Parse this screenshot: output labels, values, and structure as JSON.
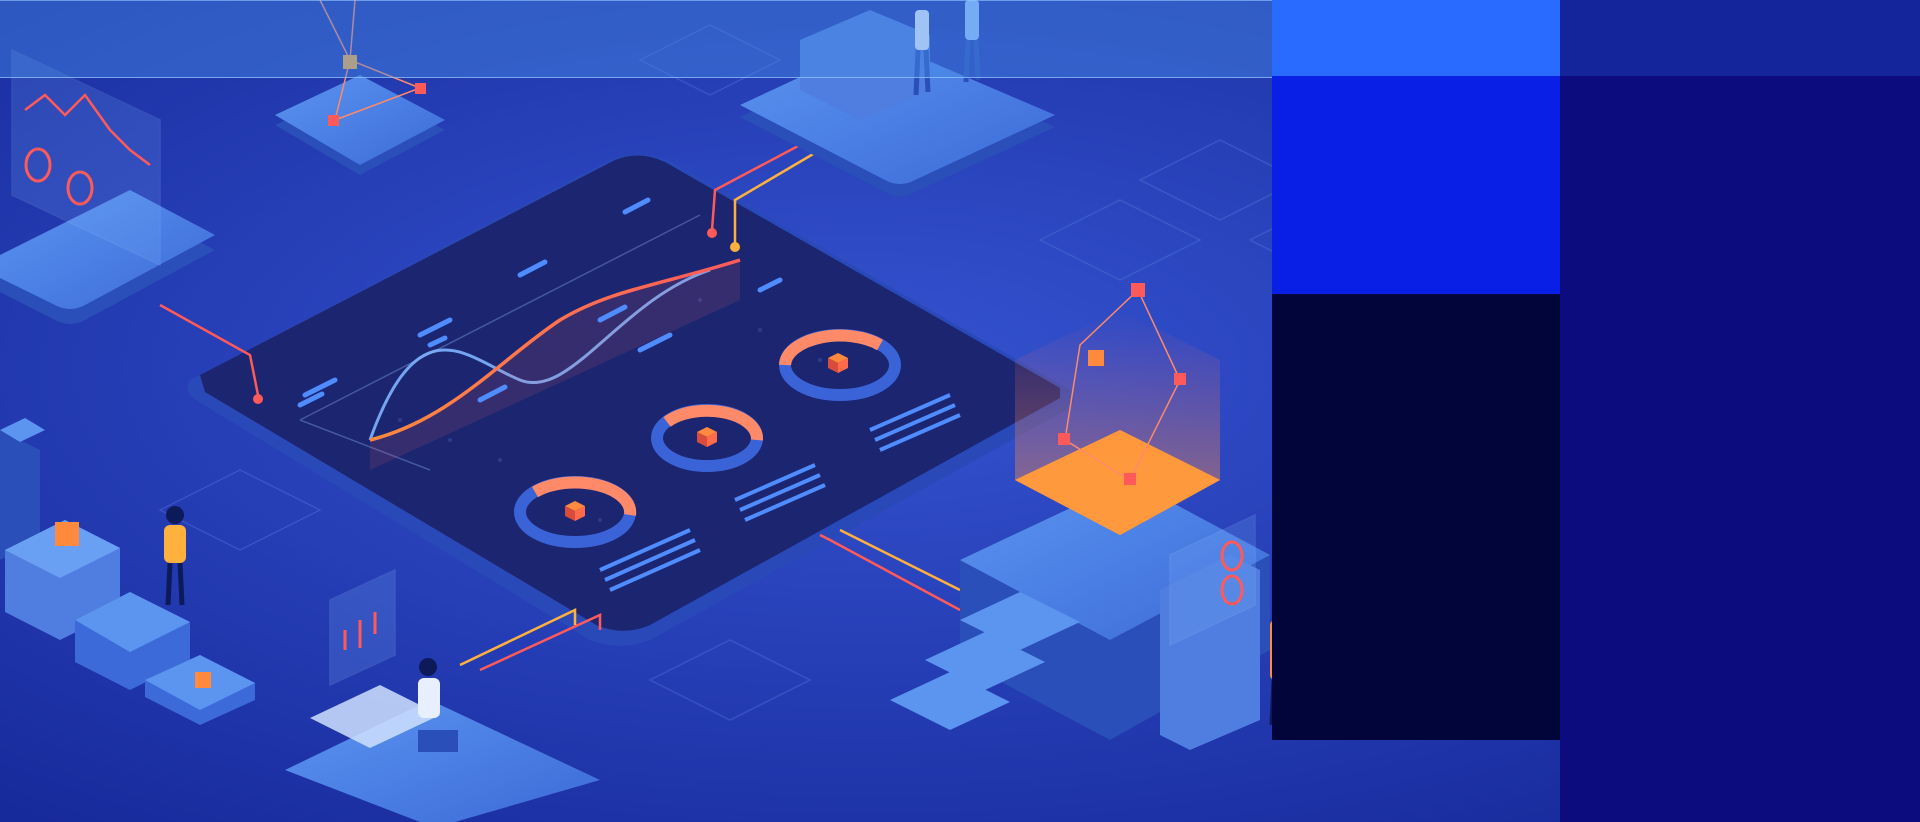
{
  "illustration": {
    "subject": "isometric-data-dashboard",
    "dashboard_panel": {
      "charts": [
        "wave-line-chart",
        "donut-chart",
        "donut-chart",
        "donut-chart"
      ]
    },
    "platforms": [
      "monitor-platform",
      "network-node-platform",
      "meeting-platform",
      "workstation-platform",
      "energy-cube-platform",
      "stepped-blocks-platform"
    ]
  },
  "colors": {
    "background": "#1a2fa8",
    "panel_dark": "#1b2570",
    "platform_top": "#4a82e8",
    "platform_side": "#2a4fb8",
    "accent_orange": "#ff8a3d",
    "accent_red": "#ff5a5a",
    "accent_light": "#7fb4ff",
    "column_bright": "#2a6bff",
    "column_blue": "#0a1fe6",
    "column_dark": "#02053a",
    "right_panel": "#0d0c7e"
  },
  "icons": [
    "cube-icon",
    "donut-chart-icon",
    "line-chart-icon",
    "person-icon",
    "network-node-icon"
  ]
}
